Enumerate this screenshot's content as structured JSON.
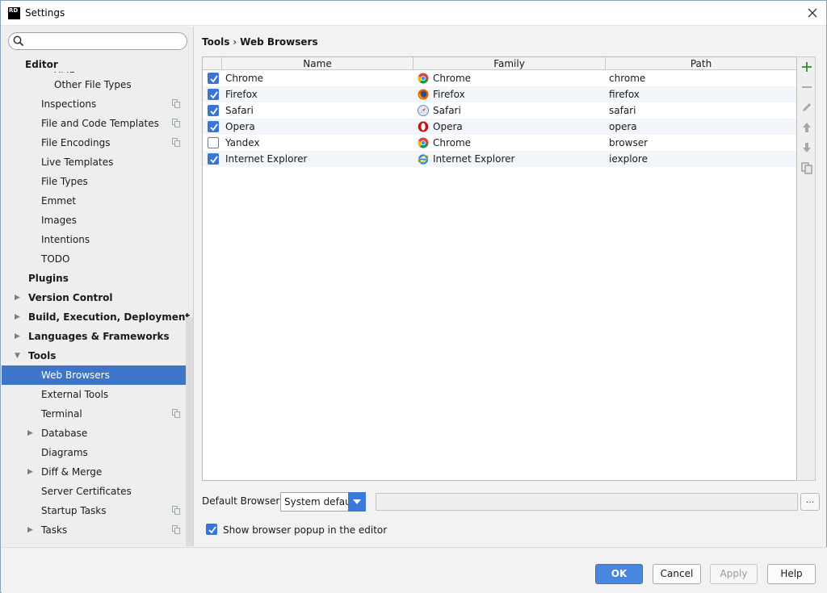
{
  "window": {
    "title": "Settings",
    "app_icon_text": "RD"
  },
  "search": {
    "placeholder": ""
  },
  "sidebar": {
    "editor_header": "Editor",
    "partial_item": "XML",
    "items": [
      {
        "label": "Other File Types",
        "indent": 2,
        "bold": false,
        "arrow": false,
        "proj": false
      },
      {
        "label": "Inspections",
        "indent": 1,
        "bold": false,
        "arrow": false,
        "proj": true
      },
      {
        "label": "File and Code Templates",
        "indent": 1,
        "bold": false,
        "arrow": false,
        "proj": true
      },
      {
        "label": "File Encodings",
        "indent": 1,
        "bold": false,
        "arrow": false,
        "proj": true
      },
      {
        "label": "Live Templates",
        "indent": 1,
        "bold": false,
        "arrow": false,
        "proj": false
      },
      {
        "label": "File Types",
        "indent": 1,
        "bold": false,
        "arrow": false,
        "proj": false
      },
      {
        "label": "Emmet",
        "indent": 1,
        "bold": false,
        "arrow": false,
        "proj": false
      },
      {
        "label": "Images",
        "indent": 1,
        "bold": false,
        "arrow": false,
        "proj": false
      },
      {
        "label": "Intentions",
        "indent": 1,
        "bold": false,
        "arrow": false,
        "proj": false
      },
      {
        "label": "TODO",
        "indent": 1,
        "bold": false,
        "arrow": false,
        "proj": false
      },
      {
        "label": "Plugins",
        "indent": 0,
        "bold": true,
        "arrow": false,
        "proj": false
      },
      {
        "label": "Version Control",
        "indent": 0,
        "bold": true,
        "arrow": "right",
        "proj": false
      },
      {
        "label": "Build, Execution, Deployment",
        "indent": 0,
        "bold": true,
        "arrow": "right",
        "proj": false
      },
      {
        "label": "Languages & Frameworks",
        "indent": 0,
        "bold": true,
        "arrow": "right",
        "proj": false
      },
      {
        "label": "Tools",
        "indent": 0,
        "bold": true,
        "arrow": "down",
        "proj": false
      },
      {
        "label": "Web Browsers",
        "indent": 1,
        "bold": false,
        "arrow": false,
        "proj": false,
        "selected": true
      },
      {
        "label": "External Tools",
        "indent": 1,
        "bold": false,
        "arrow": false,
        "proj": false
      },
      {
        "label": "Terminal",
        "indent": 1,
        "bold": false,
        "arrow": false,
        "proj": true
      },
      {
        "label": "Database",
        "indent": 1,
        "bold": false,
        "arrow": "right",
        "proj": false
      },
      {
        "label": "Diagrams",
        "indent": 1,
        "bold": false,
        "arrow": false,
        "proj": false
      },
      {
        "label": "Diff & Merge",
        "indent": 1,
        "bold": false,
        "arrow": "right",
        "proj": false
      },
      {
        "label": "Server Certificates",
        "indent": 1,
        "bold": false,
        "arrow": false,
        "proj": false
      },
      {
        "label": "Startup Tasks",
        "indent": 1,
        "bold": false,
        "arrow": false,
        "proj": true
      },
      {
        "label": "Tasks",
        "indent": 1,
        "bold": false,
        "arrow": "right",
        "proj": true
      }
    ]
  },
  "breadcrumb": {
    "parent": "Tools",
    "separator": "›",
    "current": "Web Browsers"
  },
  "table": {
    "columns": [
      "Name",
      "Family",
      "Path"
    ],
    "rows": [
      {
        "checked": true,
        "name": "Chrome",
        "family": "Chrome",
        "family_icon": "chrome-icon",
        "path": "chrome"
      },
      {
        "checked": true,
        "name": "Firefox",
        "family": "Firefox",
        "family_icon": "firefox-icon",
        "path": "firefox"
      },
      {
        "checked": true,
        "name": "Safari",
        "family": "Safari",
        "family_icon": "safari-icon",
        "path": "safari"
      },
      {
        "checked": true,
        "name": "Opera",
        "family": "Opera",
        "family_icon": "opera-icon",
        "path": "opera"
      },
      {
        "checked": false,
        "name": "Yandex",
        "family": "Chrome",
        "family_icon": "chrome-icon",
        "path": "browser"
      },
      {
        "checked": true,
        "name": "Internet Explorer",
        "family": "Internet Explorer",
        "family_icon": "ie-icon",
        "path": "iexplore"
      }
    ]
  },
  "toolbar_icons": [
    "add-icon",
    "remove-icon",
    "edit-icon",
    "move-up-icon",
    "move-down-icon",
    "copy-icon"
  ],
  "default_browser": {
    "label": "Default Browser:",
    "value": "System default",
    "path_value": "",
    "browse_label": "..."
  },
  "popup_option": {
    "label": "Show browser popup in the editor",
    "checked": true
  },
  "buttons": {
    "ok": "OK",
    "cancel": "Cancel",
    "apply": "Apply",
    "help": "Help"
  },
  "colors": {
    "selection": "#3e75c9",
    "checkbox": "#3875d7",
    "ok_button": "#4a86e0",
    "add_green": "#3c9a3c"
  }
}
